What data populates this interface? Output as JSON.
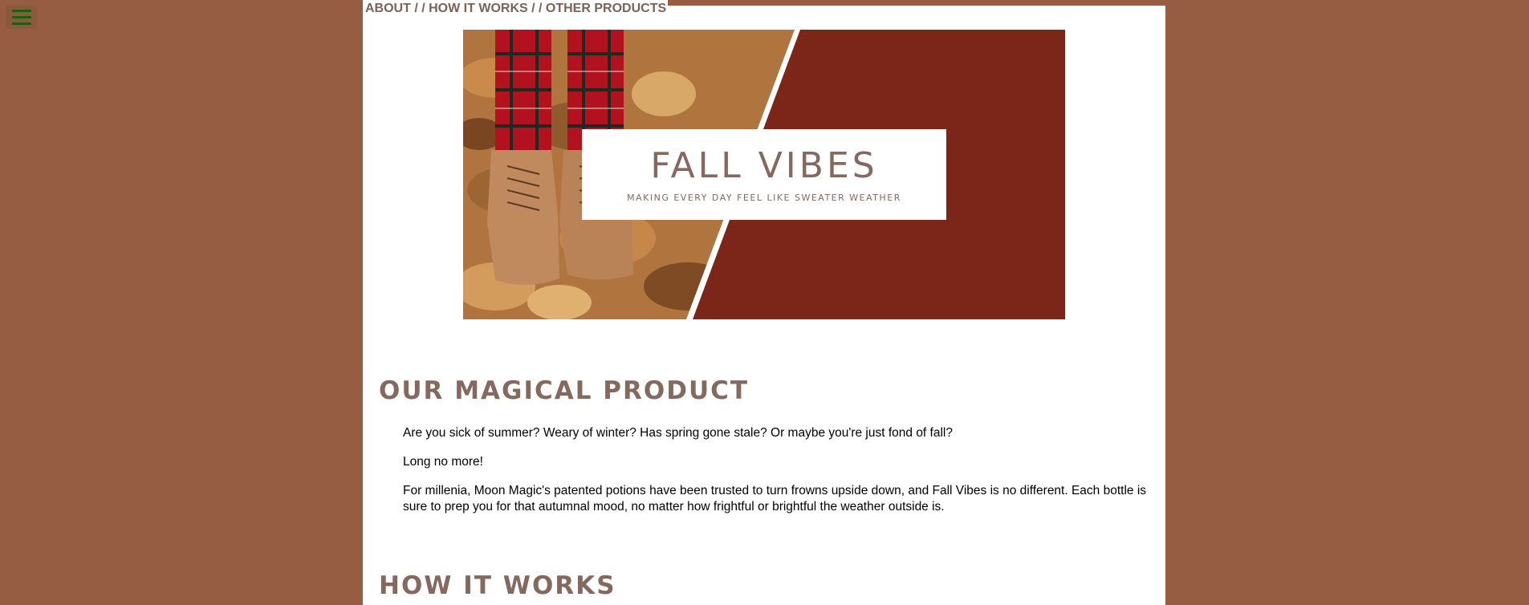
{
  "nav": {
    "about": "ABOUT",
    "sep1": " / / ",
    "how": "HOW IT WORKS",
    "sep2": " / / ",
    "other": "OTHER PRODUCTS"
  },
  "menu": {
    "icon": "hamburger-menu-icon"
  },
  "banner": {
    "title": "FALL VIBES",
    "subtitle": "MAKING EVERY DAY FEEL LIKE SWEATER WEATHER",
    "accent_color": "#7b2618"
  },
  "product": {
    "heading": "OUR MAGICAL PRODUCT",
    "p1": "Are you sick of summer? Weary of winter? Has spring gone stale? Or maybe you're just fond of fall?",
    "p2": "Long no more!",
    "p3": "For millenia, Moon Magic's patented potions have been trusted to turn frowns upside down, and Fall Vibes is no different. Each bottle is sure to prep you for that autumnal mood, no matter how frightful or brightful the weather outside is."
  },
  "how": {
    "heading": "HOW IT WORKS"
  },
  "colors": {
    "background": "#965d42",
    "heading": "#85685e",
    "menu_icon": "#1a5e12"
  }
}
